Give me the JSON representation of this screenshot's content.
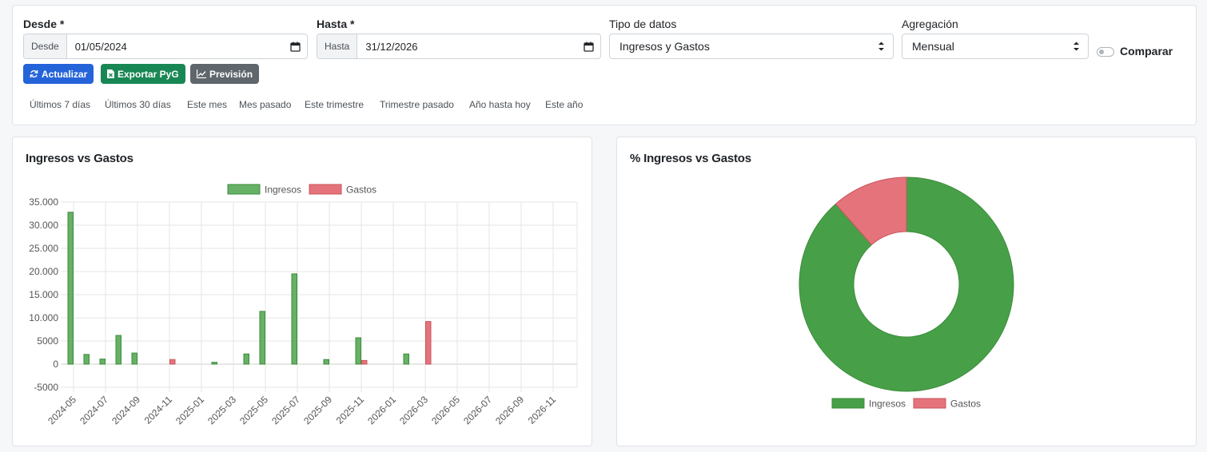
{
  "filters": {
    "desde": {
      "label": "Desde *",
      "prefix": "Desde",
      "value": "01/05/2024"
    },
    "hasta": {
      "label": "Hasta *",
      "prefix": "Hasta",
      "value": "31/12/2026"
    },
    "tipo": {
      "label": "Tipo de datos",
      "value": "Ingresos y Gastos"
    },
    "agregacion": {
      "label": "Agregación",
      "value": "Mensual"
    },
    "comparar": {
      "label": "Comparar",
      "checked": false
    }
  },
  "buttons": {
    "actualizar": "Actualizar",
    "exportar": "Exportar PyG",
    "prevision": "Previsión"
  },
  "quick_ranges": [
    "Últimos 7 días",
    "Últimos 30 días",
    "Este mes",
    "Mes pasado",
    "Este trimestre",
    "Trimestre pasado",
    "Año hasta hoy",
    "Este año"
  ],
  "colors": {
    "ingresos_fill": "#66b166",
    "ingresos_stroke": "#3c8c3c",
    "gastos_fill": "#e5737b",
    "gastos_stroke": "#c9545c",
    "donut_green": "#47a047",
    "primary": "#2563d9",
    "success": "#198754",
    "secondary": "#5f666c"
  },
  "bar_panel": {
    "title": "Ingresos vs Gastos"
  },
  "pie_panel": {
    "title": "% Ingresos vs Gastos"
  },
  "chart_data": [
    {
      "type": "bar",
      "title": "Ingresos vs Gastos",
      "categories": [
        "2024-05",
        "2024-06",
        "2024-07",
        "2024-08",
        "2024-09",
        "2024-10",
        "2024-11",
        "2024-12",
        "2025-01",
        "2025-02",
        "2025-03",
        "2025-04",
        "2025-05",
        "2025-06",
        "2025-07",
        "2025-08",
        "2025-09",
        "2025-10",
        "2025-11",
        "2025-12",
        "2026-01",
        "2026-02",
        "2026-03",
        "2026-04",
        "2026-05",
        "2026-06",
        "2026-07",
        "2026-08",
        "2026-09",
        "2026-10",
        "2026-11",
        "2026-12"
      ],
      "tick_labels": [
        "2024-05",
        "2024-07",
        "2024-09",
        "2024-11",
        "2025-01",
        "2025-03",
        "2025-05",
        "2025-07",
        "2025-09",
        "2025-11",
        "2026-01",
        "2026-03",
        "2026-05",
        "2026-07",
        "2026-09",
        "2026-11"
      ],
      "series": [
        {
          "name": "Ingresos",
          "values": [
            32800,
            2100,
            1100,
            6200,
            2400,
            0,
            0,
            0,
            0,
            400,
            0,
            2200,
            11400,
            0,
            19500,
            0,
            1000,
            0,
            5700,
            0,
            0,
            2200,
            0,
            0,
            0,
            0,
            0,
            0,
            0,
            0,
            0,
            0
          ]
        },
        {
          "name": "Gastos",
          "values": [
            0,
            0,
            0,
            0,
            0,
            0,
            1000,
            0,
            0,
            0,
            0,
            0,
            0,
            0,
            0,
            0,
            0,
            0,
            800,
            0,
            0,
            0,
            9200,
            0,
            0,
            0,
            0,
            0,
            0,
            0,
            0,
            0
          ]
        }
      ],
      "ylim": [
        -5000,
        35000
      ],
      "yticks": [
        35000,
        30000,
        25000,
        20000,
        15000,
        10000,
        5000,
        0,
        -5000
      ],
      "ytick_labels": [
        "35.000",
        "30.000",
        "25.000",
        "20.000",
        "15.000",
        "10.000",
        "5000",
        "0",
        "-5000"
      ],
      "legend": "top",
      "grid": true
    },
    {
      "type": "pie",
      "title": "% Ingresos vs Gastos",
      "labels": [
        "Ingresos",
        "Gastos"
      ],
      "values": [
        88.5,
        11.5
      ],
      "legend": "bottom"
    }
  ]
}
